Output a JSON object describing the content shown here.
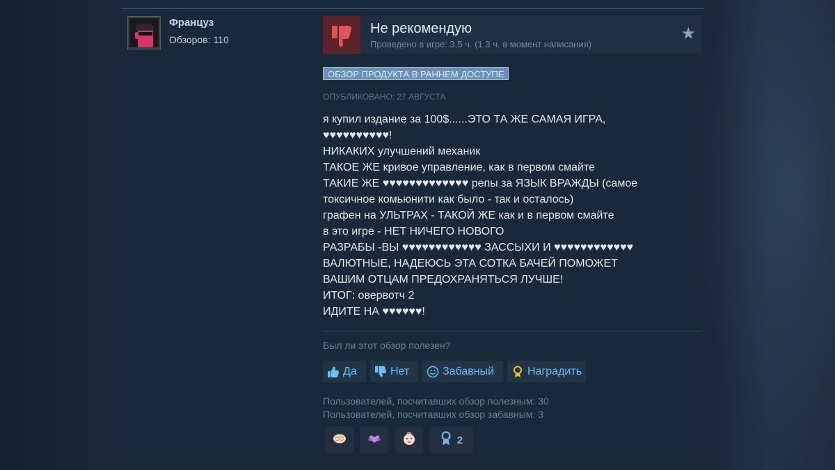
{
  "author": {
    "name": "Француз",
    "reviews_count": "Обзоров: 110"
  },
  "review": {
    "verdict": "Не рекомендую",
    "hours": "Проведено в игре: 3.5 ч. (1.3 ч. в момент написания)",
    "early_access_badge": "ОБЗОР ПРОДУКТА В РАННЕМ ДОСТУПЕ",
    "posted": "ОПУБЛИКОВАНО: 27 АВГУСТА",
    "body_lines": [
      "я купил издание за 100$......ЭТО ТА ЖЕ САМАЯ ИГРА,",
      "♥♥♥♥♥♥♥♥♥♥!",
      "НИКАКИХ улучшений механик",
      "ТАКОЕ ЖЕ кривое управление, как в первом смайте",
      "ТАКИЕ ЖЕ ♥♥♥♥♥♥♥♥♥♥♥♥♥ репы за ЯЗЫК ВРАЖДЫ (самое",
      "токсичное комьюнити как было - так и осталось)",
      "графен на УЛЬТРАХ - ТАКОЙ ЖЕ как и в первом смайте",
      "в это игре - НЕТ НИЧЕГО НОВОГО",
      "РАЗРАБЫ -ВЫ ♥♥♥♥♥♥♥♥♥♥♥♥ ЗАССЫХИ И ♥♥♥♥♥♥♥♥♥♥♥♥",
      "ВАЛЮТНЫЕ, НАДЕЮСЬ ЭТА СОТКА БАЧЕЙ ПОМОЖЕТ",
      "ВАШИМ ОТЦАМ ПРЕДОХРАНЯТЬСЯ ЛУЧШЕ!",
      "ИТОГ: овервотч 2",
      "ИДИТЕ НА ♥♥♥♥♥♥!"
    ]
  },
  "feedback": {
    "question": "Был ли этот обзор полезен?",
    "yes_label": "Да",
    "no_label": "Нет",
    "funny_label": "Забавный",
    "award_label": "Наградить",
    "helpful_stat": "Пользователей, посчитавших обзор полезным: 30",
    "funny_stat": "Пользователей, посчитавших обзор забавным: 3"
  },
  "awards": [
    {
      "icon": "brain-icon"
    },
    {
      "icon": "heart-hands-icon"
    },
    {
      "icon": "baby-face-icon"
    },
    {
      "icon": "ribbon-award-icon",
      "count": "2"
    }
  ],
  "colors": {
    "background": "#1b2838",
    "panel": "#1a2939",
    "link_blue": "#67c1f5",
    "negative_thumb_bg": "#5b2328",
    "negative_thumb": "#e0555c",
    "badge_bg": "#6c8fb8"
  }
}
